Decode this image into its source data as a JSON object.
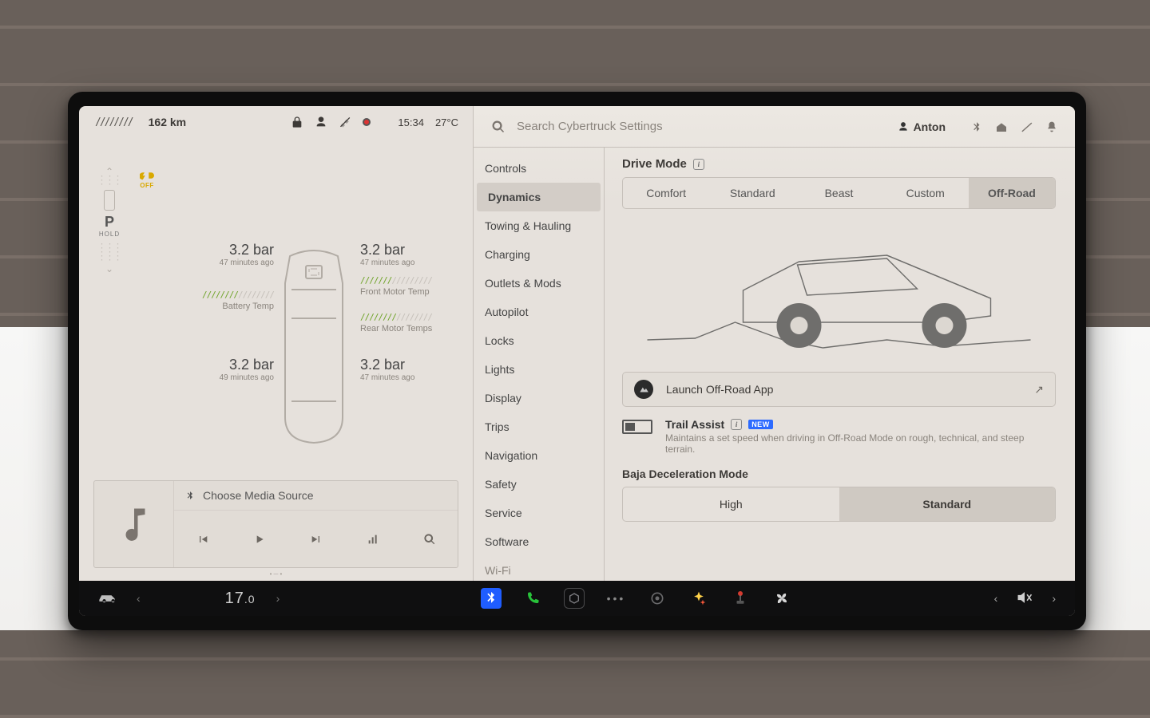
{
  "status": {
    "range": "162 km",
    "time": "15:34",
    "temp": "27°C"
  },
  "gear": {
    "letter": "P",
    "label": "HOLD",
    "tcl": "OFF"
  },
  "tires": {
    "fl": {
      "value": "3.2 bar",
      "ago": "47 minutes ago"
    },
    "fr": {
      "value": "3.2 bar",
      "ago": "47 minutes ago"
    },
    "rl": {
      "value": "3.2 bar",
      "ago": "49 minutes ago"
    },
    "rr": {
      "value": "3.2 bar",
      "ago": "47 minutes ago"
    }
  },
  "temps": {
    "battery_label": "Battery Temp",
    "front_label": "Front Motor Temp",
    "rear_label": "Rear Motor Temps"
  },
  "media": {
    "placeholder": "Choose Media Source"
  },
  "search": {
    "placeholder": "Search Cybertruck Settings"
  },
  "user": {
    "name": "Anton"
  },
  "sidebar": {
    "items": [
      "Controls",
      "Dynamics",
      "Towing & Hauling",
      "Charging",
      "Outlets & Mods",
      "Autopilot",
      "Locks",
      "Lights",
      "Display",
      "Trips",
      "Navigation",
      "Safety",
      "Service",
      "Software",
      "Wi-Fi"
    ],
    "active_index": 1
  },
  "drive_mode": {
    "title": "Drive Mode",
    "tabs": [
      "Comfort",
      "Standard",
      "Beast",
      "Custom",
      "Off-Road"
    ],
    "active_index": 4
  },
  "launch": {
    "label": "Launch Off-Road App"
  },
  "trail": {
    "title": "Trail Assist",
    "badge": "NEW",
    "desc": "Maintains a set speed when driving in Off-Road Mode on rough, technical, and steep terrain."
  },
  "baja": {
    "title": "Baja Deceleration Mode",
    "options": [
      "High",
      "Standard"
    ],
    "active_index": 1
  },
  "dock": {
    "climate": "17",
    "climate_dec": ".0"
  }
}
